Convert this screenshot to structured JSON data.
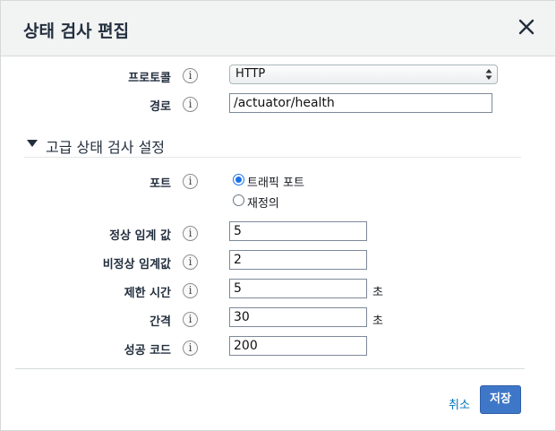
{
  "dialog": {
    "title": "상태 검사 편집",
    "close_icon": "close-icon"
  },
  "protocol": {
    "label": "프로토콜",
    "value": "HTTP",
    "info": "i"
  },
  "path": {
    "label": "경로",
    "value": "/actuator/health",
    "info": "i"
  },
  "advanced": {
    "title": "고급 상태 검사 설정"
  },
  "port": {
    "label": "포트",
    "info": "i",
    "options": [
      {
        "label": "트래픽 포트",
        "checked": true
      },
      {
        "label": "재정의",
        "checked": false
      }
    ]
  },
  "healthy_threshold": {
    "label": "정상 임계 값",
    "value": "5",
    "info": "i"
  },
  "unhealthy_threshold": {
    "label": "비정상 임계값",
    "value": "2",
    "info": "i"
  },
  "timeout": {
    "label": "제한 시간",
    "value": "5",
    "unit": "초",
    "info": "i"
  },
  "interval": {
    "label": "간격",
    "value": "30",
    "unit": "초",
    "info": "i"
  },
  "success_codes": {
    "label": "성공 코드",
    "value": "200",
    "info": "i"
  },
  "footer": {
    "cancel_label": "취소",
    "save_label": "저장"
  },
  "colors": {
    "accent": "#3f77c8",
    "link": "#0073bb",
    "header_bg": "#f2f3f3"
  }
}
